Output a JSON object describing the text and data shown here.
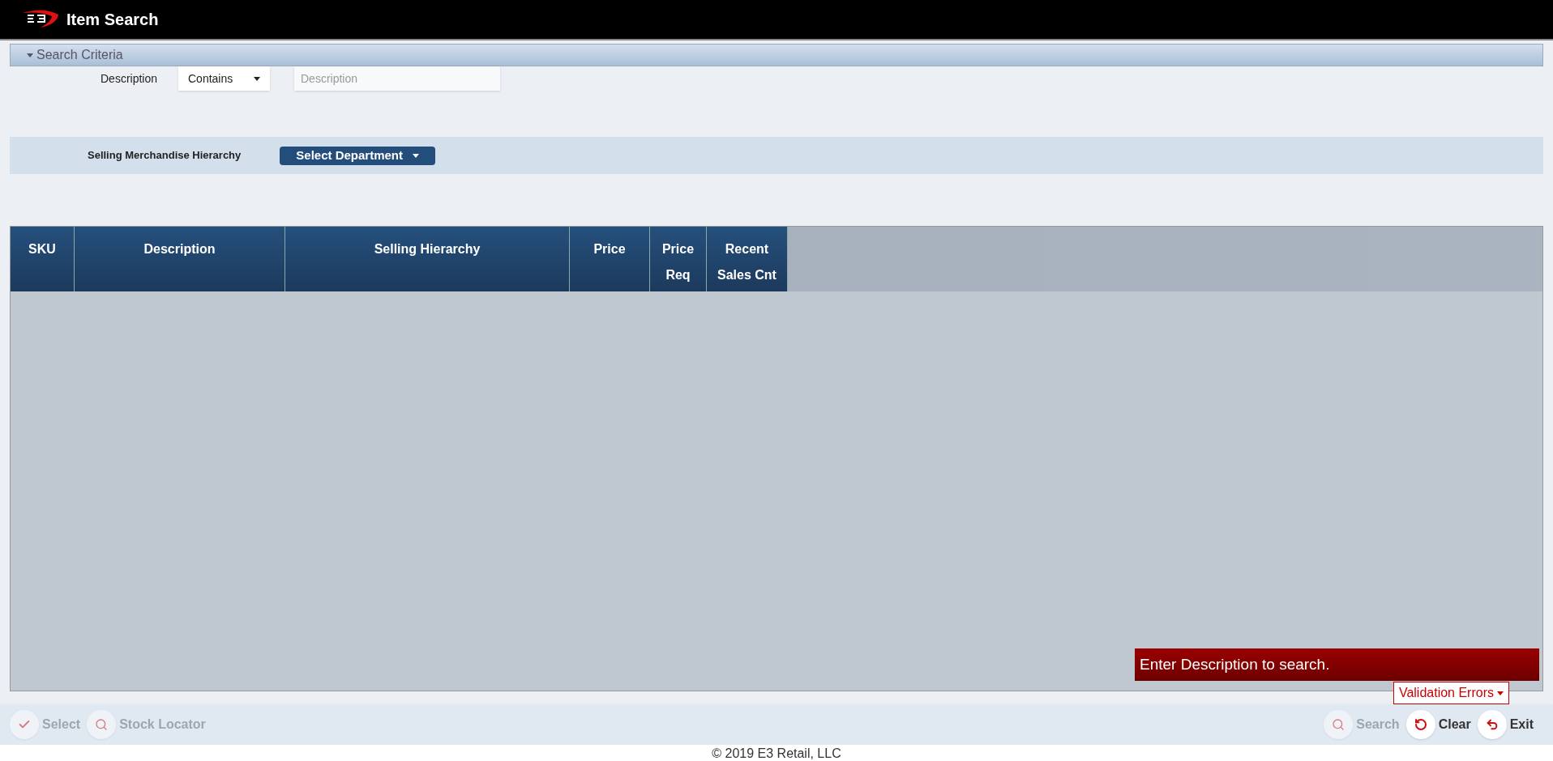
{
  "header": {
    "title": "Item Search"
  },
  "search_criteria": {
    "title": "Search Criteria",
    "expanded": true,
    "description_label": "Description",
    "operator": "Contains",
    "description_field": {
      "placeholder": "Description"
    },
    "hierarchy_label": "Selling Merchandise Hierarchy",
    "department_button": "Select Department"
  },
  "table": {
    "columns": [
      {
        "lines": [
          "SKU"
        ]
      },
      {
        "lines": [
          "Description"
        ]
      },
      {
        "lines": [
          "Selling Hierarchy"
        ]
      },
      {
        "lines": [
          "Price"
        ]
      },
      {
        "lines": [
          "Price",
          "Req"
        ]
      },
      {
        "lines": [
          "Recent",
          "Sales Cnt"
        ]
      }
    ]
  },
  "error_message": "Enter Description to search.",
  "validation_errors": "Validation Errors",
  "toolbar": {
    "left": [
      {
        "label": "Select",
        "kind": "check",
        "disabled": true
      },
      {
        "label": "Stock Locator",
        "kind": "search",
        "disabled": true
      }
    ],
    "right": [
      {
        "label": "Search",
        "kind": "search",
        "disabled": true
      },
      {
        "label": "Clear",
        "kind": "undo",
        "disabled": false
      },
      {
        "label": "Exit",
        "kind": "back",
        "disabled": false
      }
    ]
  },
  "footer": "© 2019 E3 Retail, LLC"
}
